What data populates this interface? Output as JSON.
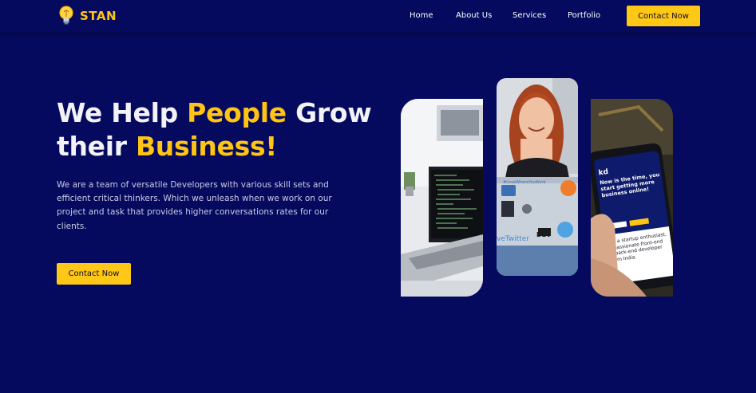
{
  "brand": {
    "name": "STAN",
    "logo_icon": "lightbulb-icon"
  },
  "nav": {
    "items": [
      {
        "label": "Home"
      },
      {
        "label": "About Us"
      },
      {
        "label": "Services"
      },
      {
        "label": "Portfolio"
      }
    ],
    "cta_label": "Contact Now"
  },
  "hero": {
    "title_part1": "We Help ",
    "title_highlight1": "People",
    "title_part2": " Grow",
    "title_part3": "their ",
    "title_highlight2": "Business!",
    "description": "We are a team of versatile Developers with various skill sets and efficient critical thinkers. Which we unleash when we work on our project and task that provides higher conversations rates for our clients.",
    "cta_label": "Contact Now"
  },
  "gallery": {
    "photos": [
      {
        "subject": "laptop with code on desk"
      },
      {
        "subject": "smiling woman with laptop"
      },
      {
        "subject": "hand holding phone showing website"
      }
    ],
    "laptop_sticker_tag": "#LoveWhereYouWork",
    "laptop_sticker_twitter": "veTwitter",
    "laptop_sticker_dev": "DEV",
    "phone_screen_logo": "kd",
    "phone_screen_heading": "Now is the time, you start getting more business online!",
    "phone_screen_body": "I'm a startup enthusiast, a passionate front-end & back-end developer from India."
  },
  "colors": {
    "background": "#050a5e",
    "accent": "#ffc414",
    "title_text": "#f2f2f7",
    "body_text": "#c9cbe6"
  }
}
